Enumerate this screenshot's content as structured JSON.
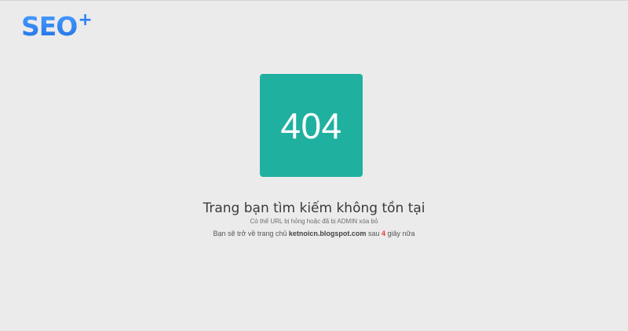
{
  "logo": {
    "text": "SEO",
    "superscript": "+",
    "color": "#2f82f2"
  },
  "error": {
    "code": "404",
    "box_color": "#20b0a0"
  },
  "message": {
    "heading": "Trang bạn tìm kiếm không tồn tại",
    "subline": "Có thể URL bị hỏng hoặc đã bị ADMIN xóa bỏ",
    "redirect_prefix": "Bạn sẽ trở về trang chủ",
    "redirect_site": "ketnoicn.blogspot.com",
    "redirect_middle": "sau",
    "countdown_seconds": "4",
    "redirect_suffix": "giây nữa",
    "countdown_color": "#e53935"
  }
}
